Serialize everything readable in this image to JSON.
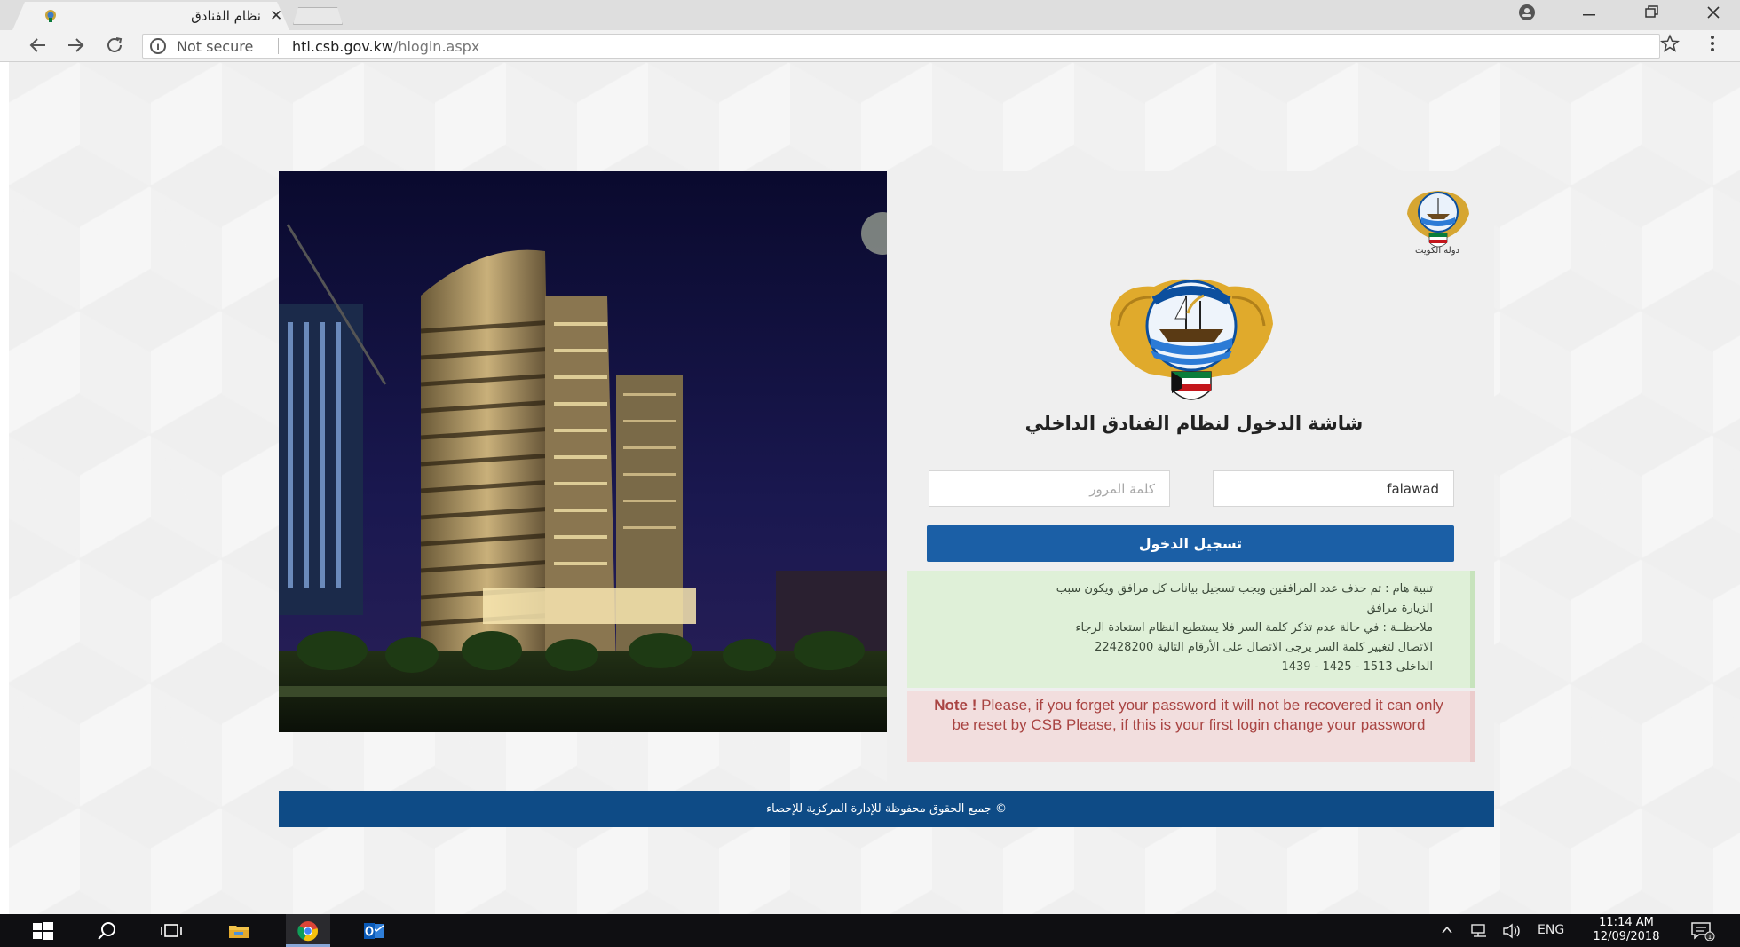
{
  "browser": {
    "tab_title": "نظام الفنادق",
    "tab_close": "✕",
    "security_label": "Not secure",
    "url_host": "htl.csb.gov.kw",
    "url_path": "/hlogin.aspx"
  },
  "header": {
    "small_emblem_caption": "دولة الكويت"
  },
  "login": {
    "title": "شاشة الدخول لنظام الفنادق الداخلي",
    "username_value": "falawad",
    "password_placeholder": "كلمة المرور",
    "submit_label": "تسجيل الدخول"
  },
  "notice_ar": {
    "line1": "تنبية هام : تم حذف عدد المرافقين ويجب تسجيل بيانات كل مرافق ويكون سبب",
    "line2": "الزيارة مرافق",
    "line3": "ملاحظــة : في حالة عدم تذكر كلمة السر فلا يستطيع النظام استعادة الرجاء",
    "line4": "الاتصال لتغيير كلمة السر يرجى الاتصال على الأرقام التالية 22428200",
    "line5": "الداخلى 1513 - 1425 - 1439"
  },
  "notice_en": {
    "label": "Note !",
    "text": " Please, if you forget your password it will not be recovered it can only be reset by CSB Please, if this is your first login change your password"
  },
  "footer": {
    "copyright": "© جميع الحقوق محفوظة للإدارة المركزية للإحصاء"
  },
  "taskbar": {
    "language": "ENG",
    "time": "11:14 AM",
    "date": "12/09/2018",
    "notification_count": "1"
  }
}
